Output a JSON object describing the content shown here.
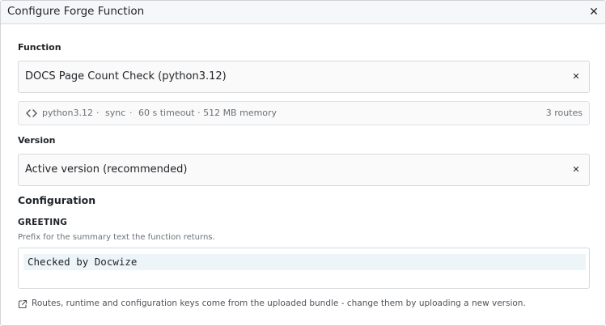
{
  "dialog": {
    "title": "Configure Forge Function",
    "close_icon": "close-icon"
  },
  "function": {
    "label": "Function",
    "selected": "DOCS Page Count Check (python3.12)",
    "clear_icon": "clear-icon"
  },
  "meta": {
    "icon": "code-icon",
    "runtime": "python3.12",
    "separator": "·",
    "mode": "sync",
    "limits": "60 s timeout · 512 MB memory",
    "routes": "3 routes"
  },
  "version": {
    "label": "Version",
    "selected": "Active version (recommended)",
    "clear_icon": "clear-icon"
  },
  "configuration": {
    "title": "Configuration",
    "key": "GREETING",
    "help": "Prefix for the summary text the function returns.",
    "value": "Checked by Docwize"
  },
  "footer": {
    "icon": "external-link-icon",
    "note": "Routes, runtime and configuration keys come from the uploaded bundle - change them by uploading a new version."
  }
}
